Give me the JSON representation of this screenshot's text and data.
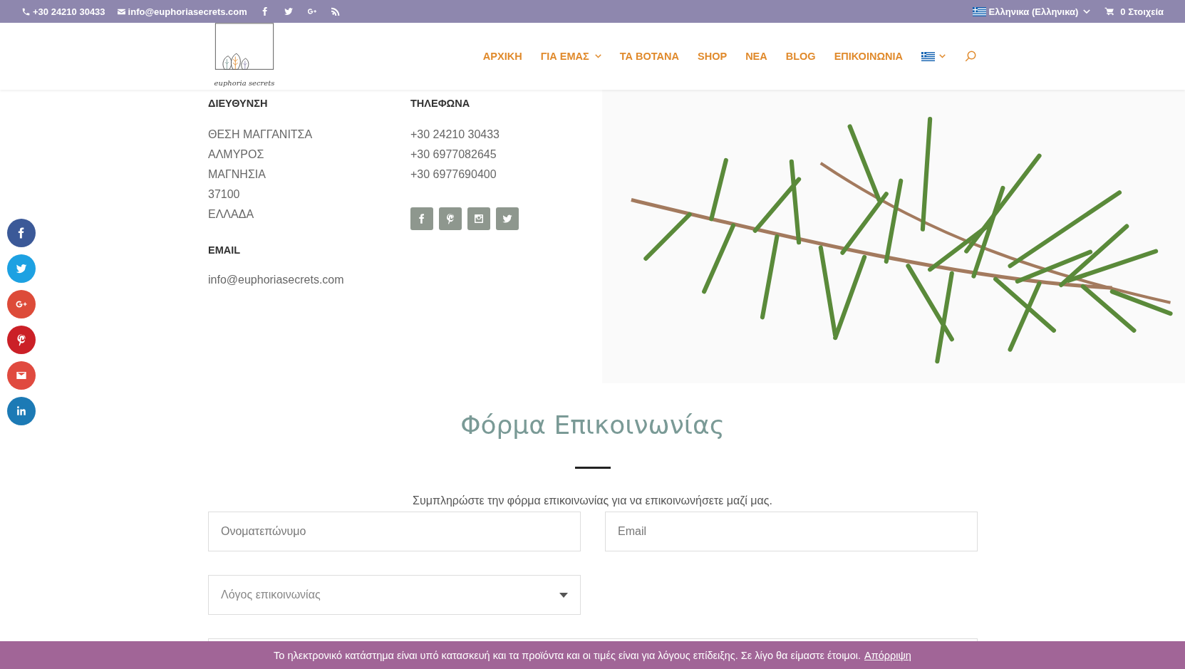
{
  "top_bar": {
    "phone": "+30 24210 30433",
    "email": "info@euphoriasecrets.com",
    "social": [
      {
        "kind": "facebook"
      },
      {
        "kind": "twitter"
      },
      {
        "kind": "googleplus"
      },
      {
        "kind": "rss"
      }
    ],
    "language": "Ελληνικα (Ελληνικα)",
    "cart": "0 Στοιχεία"
  },
  "logo": {
    "text": "euphoria secrets"
  },
  "nav": {
    "items": [
      {
        "label": "ΑΡΧΙΚΗ",
        "dropdown": false
      },
      {
        "label": "ΓΙΑ ΕΜΑΣ",
        "dropdown": true
      },
      {
        "label": "ΤΑ ΒΟΤΑΝΑ",
        "dropdown": false
      },
      {
        "label": "SHOP",
        "dropdown": false
      },
      {
        "label": "ΝΕΑ",
        "dropdown": false
      },
      {
        "label": "BLOG",
        "dropdown": false
      },
      {
        "label": "ΕΠΙΚΟΙΝΩΝΙΑ",
        "dropdown": false
      }
    ],
    "language_dropdown": true
  },
  "address": {
    "heading": "ΔΙΕΥΘΥΝΣΗ",
    "lines": [
      "ΘΕΣΗ ΜΑΓΓΑΝΙΤΣΑ",
      "ΑΛΜΥΡΟΣ",
      "ΜΑΓΝΗΣΙΑ",
      "37100",
      "ΕΛΛΑΔΑ"
    ]
  },
  "phones": {
    "heading": "ΤΗΛΕΦΩΝΑ",
    "numbers": [
      "+30 24210 30433",
      "+30 6977082645",
      "+30 6977690400"
    ],
    "follow": [
      {
        "kind": "facebook"
      },
      {
        "kind": "pinterest"
      },
      {
        "kind": "instagram"
      },
      {
        "kind": "twitter"
      }
    ]
  },
  "email": {
    "heading": "EMAIL",
    "address": "info@euphoriasecrets.com"
  },
  "share_buttons": [
    {
      "kind": "facebook",
      "color": "#3b5998"
    },
    {
      "kind": "twitter",
      "color": "#1da1e2"
    },
    {
      "kind": "googleplus",
      "color": "#dd4b39"
    },
    {
      "kind": "pinterest",
      "color": "#cb2027"
    },
    {
      "kind": "email",
      "color": "#e04a3f"
    },
    {
      "kind": "linkedin",
      "color": "#1c7ab5"
    }
  ],
  "form": {
    "title": "Φόρμα Επικοινωνίας",
    "intro": "Συμπληρώστε την φόρμα επικοινωνίας για να επικοινωνήσετε μαζί μας.",
    "fields": [
      {
        "kind": "text",
        "placeholder": "Ονοματεπώνυμο"
      },
      {
        "kind": "text",
        "placeholder": "Email"
      },
      {
        "kind": "select",
        "placeholder": "Λόγος επικοινωνίας"
      }
    ]
  },
  "notice": {
    "text": "Το ηλεκτρονικό κατάστημα είναι υπό κατασκευή και τα προϊόντα και οι τιμές είναι για λόγους επίδειξης. Σε λίγο θα είμαστε έτοιμοι.",
    "link": "Απόρριψη"
  }
}
